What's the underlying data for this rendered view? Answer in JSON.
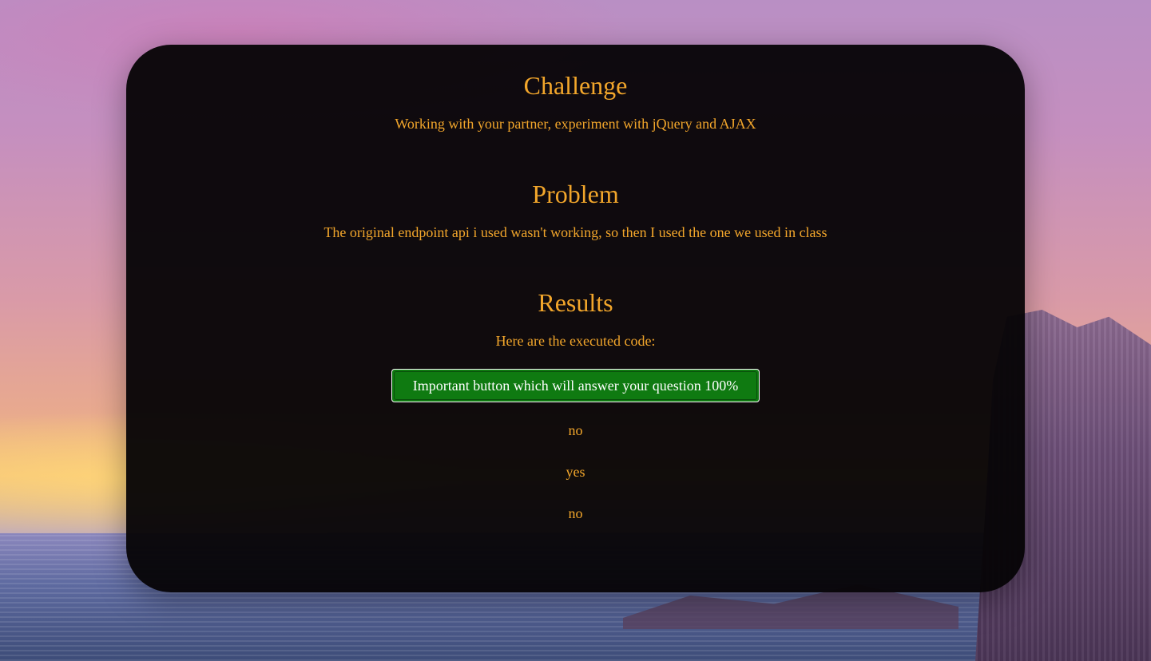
{
  "sections": {
    "challenge": {
      "title": "Challenge",
      "text": "Working with your partner, experiment with jQuery and AJAX"
    },
    "problem": {
      "title": "Problem",
      "text": "The original endpoint api i used wasn't working, so then I used the one we used in class"
    },
    "results": {
      "title": "Results",
      "text": "Here are the executed code:",
      "button_label": "Important button which will answer your question 100%",
      "answers": [
        "no",
        "yes",
        "no"
      ]
    }
  },
  "colors": {
    "text": "#f2a62b",
    "button_bg": "#0f7a11",
    "button_text": "#ffffff",
    "panel_bg": "#060406"
  }
}
